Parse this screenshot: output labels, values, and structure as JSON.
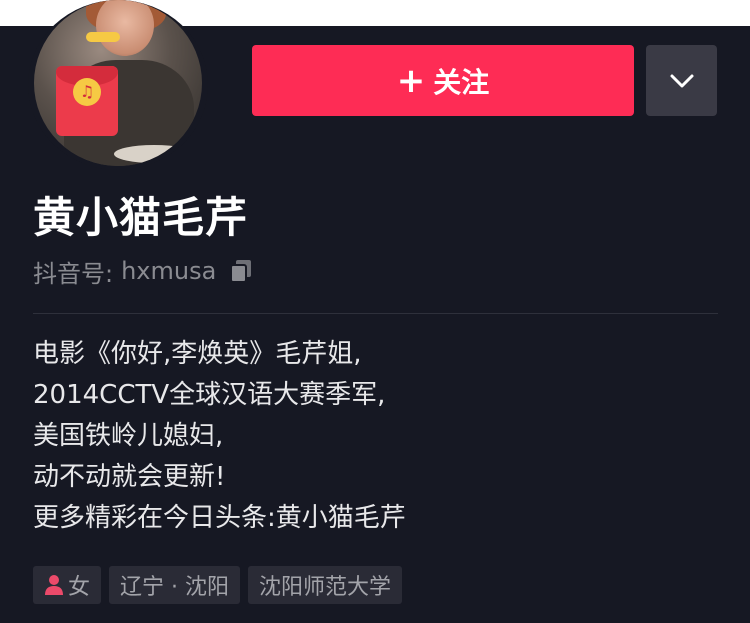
{
  "colors": {
    "background": "#161823",
    "accent": "#fe2c55",
    "secondary_button": "#3a3a45",
    "muted_text": "#8a8b91",
    "tag_background": "#2a2b36",
    "gender_icon": "#ec4a6a"
  },
  "profile": {
    "avatar_icon": "red-packet-music-icon",
    "name": "黄小猫毛芹",
    "id_label": "抖音号:",
    "id_value": "hxmusa",
    "copy_icon": "copy-icon"
  },
  "actions": {
    "follow_plus": "+",
    "follow_label": "关注",
    "more_icon": "chevron-down-icon"
  },
  "bio": {
    "lines": [
      "电影《你好,李焕英》毛芹姐,",
      "2014CCTV全球汉语大赛季军,",
      "美国铁岭儿媳妇,",
      "动不动就会更新!",
      "更多精彩在今日头条:黄小猫毛芹"
    ]
  },
  "tags": {
    "gender": "女",
    "gender_icon": "person-icon",
    "location": "辽宁 · 沈阳",
    "school": "沈阳师范大学"
  }
}
